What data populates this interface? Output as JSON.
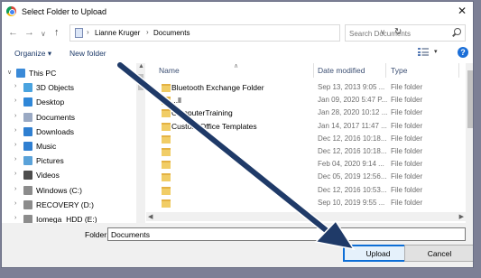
{
  "window": {
    "title": "Select Folder to Upload",
    "close_glyph": "✕"
  },
  "address_bar": {
    "crumbs": [
      "Lianne Kruger",
      "Documents"
    ],
    "separator": "›",
    "back_glyph": "←",
    "forward_glyph": "→",
    "dropdown_glyph": "∨",
    "up_glyph": "↑",
    "refresh_glyph": "↻",
    "addr_dropdown_glyph": "∨"
  },
  "search": {
    "placeholder": "Search Documents"
  },
  "toolbar": {
    "organize": "Organize ▾",
    "new_folder": "New folder",
    "view_dropdown": "▾",
    "help": "?"
  },
  "nav_tree": [
    {
      "label": "This PC",
      "expanded": true,
      "icon": "monitor-icon",
      "color": "#3a8ad8"
    },
    {
      "label": "3D Objects",
      "icon": "3d-objects-icon",
      "color": "#4aa3df"
    },
    {
      "label": "Desktop",
      "icon": "desktop-icon",
      "color": "#2f87d8"
    },
    {
      "label": "Documents",
      "icon": "documents-icon",
      "color": "#9aa9c3"
    },
    {
      "label": "Downloads",
      "icon": "downloads-icon",
      "color": "#2f7fd1"
    },
    {
      "label": "Music",
      "icon": "music-icon",
      "color": "#2f7fd1"
    },
    {
      "label": "Pictures",
      "icon": "pictures-icon",
      "color": "#5aa2d9"
    },
    {
      "label": "Videos",
      "icon": "videos-icon",
      "color": "#4d4d4d"
    },
    {
      "label": "Windows (C:)",
      "icon": "drive-icon",
      "color": "#8c8c8c"
    },
    {
      "label": "RECOVERY (D:)",
      "icon": "drive-icon",
      "color": "#8c8c8c"
    },
    {
      "label": "Iomega_HDD (E:)",
      "icon": "drive-icon",
      "color": "#8c8c8c"
    }
  ],
  "columns": {
    "name": "Name",
    "date": "Date modified",
    "type": "Type",
    "sort_glyph": "∧"
  },
  "files": [
    {
      "name": "Bluetooth Exchange Folder",
      "date": "Sep 13, 2013 9:05 ...",
      "type": "File folder"
    },
    {
      "name": "...ll",
      "date": "Jan 09, 2020 5:47 P...",
      "type": "File folder"
    },
    {
      "name": "ComputerTraining",
      "date": "Jan 28, 2020 10:12 ...",
      "type": "File folder"
    },
    {
      "name": "Custom Office Templates",
      "date": "Jan 14, 2017 11:47 ...",
      "type": "File folder"
    },
    {
      "name": "",
      "date": "Dec 12, 2016 10:18...",
      "type": "File folder"
    },
    {
      "name": "",
      "date": "Dec 12, 2016 10:18...",
      "type": "File folder"
    },
    {
      "name": "",
      "date": "Feb 04, 2020 9:14 ...",
      "type": "File folder"
    },
    {
      "name": "",
      "date": "Dec 05, 2019 12:56...",
      "type": "File folder"
    },
    {
      "name": "",
      "date": "Dec 12, 2016 10:53...",
      "type": "File folder"
    },
    {
      "name": "",
      "date": "Sep 10, 2019 9:55 ...",
      "type": "File folder"
    }
  ],
  "bottom": {
    "folder_label": "Folder:",
    "folder_value": "Documents",
    "upload": "Upload",
    "cancel": "Cancel"
  },
  "colors": {
    "annotation_arrow": "#1f3a68",
    "primary_border": "#0d6ed6"
  }
}
